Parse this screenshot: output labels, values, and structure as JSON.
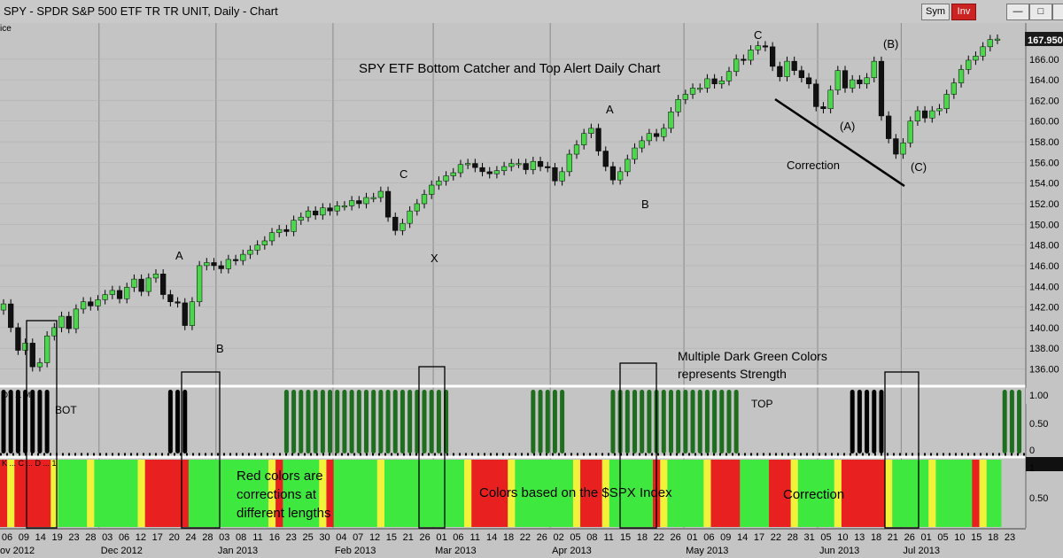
{
  "window": {
    "title": "SPY - SPDR S&P 500 ETF TR TR UNIT, Daily - Chart",
    "sym_button": "Sym",
    "inv_button": "Inv",
    "top_left_fragment": "ice"
  },
  "colors": {
    "up_candle": "#4dd64d",
    "down_candle": "#111111",
    "dark_green": "#1f6e1f",
    "black_bar": "#000000",
    "red": "#e82020",
    "yellow": "#f2f23a",
    "light_green": "#3fe83f",
    "panel_bg": "#c4c4c4",
    "price_label_bg": "#1a1a1a"
  },
  "annotations": {
    "chart_title": "SPY ETF Bottom Catcher and Top Alert Daily Chart",
    "wave_labels": [
      "A",
      "B",
      "C",
      "X",
      "A",
      "B",
      "C",
      "(A)",
      "(B)",
      "(C)"
    ],
    "correction_upper": "Correction",
    "bot_label": "BOT",
    "top_label": "TOP",
    "strength_line1": "Multiple Dark Green Colors",
    "strength_line2": "represents Strength",
    "red_note_line1": "Red colors are",
    "red_note_line2": "corrections at",
    "red_note_line3": "different lengths",
    "spx_note": "Colors based on the $SPX Index",
    "correction_lower": "Correction",
    "panel2_label": "OT ... M",
    "panel3_label": "K ... C ... D ... 1"
  },
  "price_label": "167.950",
  "chart_data": [
    {
      "type": "candlestick",
      "title": "SPY ETF Bottom Catcher and Top Alert Daily Chart",
      "ylim": [
        134.5,
        169.5
      ],
      "yticks": [
        "136.00",
        "138.00",
        "140.00",
        "142.00",
        "144.00",
        "146.00",
        "148.00",
        "150.00",
        "152.00",
        "154.00",
        "156.00",
        "158.00",
        "160.00",
        "162.00",
        "164.00",
        "166.00"
      ],
      "last_price": 167.95,
      "closes": [
        142.3,
        140.0,
        137.8,
        138.5,
        136.2,
        136.6,
        139.2,
        140.0,
        141.1,
        139.9,
        141.8,
        142.5,
        142.1,
        142.7,
        143.2,
        143.6,
        142.8,
        143.9,
        144.7,
        143.5,
        144.8,
        145.2,
        143.2,
        142.5,
        142.4,
        140.2,
        142.5,
        146.0,
        146.3,
        146.0,
        145.7,
        146.6,
        146.5,
        147.1,
        147.5,
        148.0,
        148.4,
        149.2,
        149.5,
        149.3,
        150.4,
        150.7,
        151.3,
        150.9,
        151.6,
        151.3,
        151.8,
        151.8,
        152.3,
        152.0,
        152.6,
        152.6,
        153.2,
        150.7,
        149.4,
        150.1,
        151.3,
        152.0,
        152.9,
        153.8,
        154.2,
        154.7,
        155.0,
        155.8,
        155.9,
        155.5,
        155.1,
        154.9,
        155.2,
        155.6,
        155.9,
        155.9,
        155.3,
        156.1,
        155.6,
        155.5,
        154.2,
        155.1,
        156.8,
        157.7,
        158.8,
        159.3,
        157.1,
        155.6,
        154.3,
        155.1,
        156.3,
        157.4,
        158.1,
        158.8,
        158.5,
        159.3,
        160.9,
        162.1,
        162.6,
        163.2,
        163.2,
        164.1,
        163.6,
        163.9,
        164.8,
        166.0,
        165.9,
        166.9,
        167.3,
        167.2,
        165.3,
        164.3,
        165.8,
        164.9,
        164.2,
        163.6,
        161.4,
        161.2,
        163.0,
        164.9,
        163.2,
        164.0,
        163.6,
        164.2,
        165.8,
        160.5,
        158.3,
        156.8,
        157.9,
        160.0,
        161.0,
        160.3,
        161.0,
        161.2,
        162.6,
        163.7,
        165.0,
        165.9,
        166.3,
        167.2,
        167.9,
        167.95
      ]
    },
    {
      "type": "bar",
      "name_label": "OT ... M",
      "ylim": [
        0,
        1
      ],
      "yticks": [
        "1.00",
        "0.50",
        "0"
      ],
      "colors": [
        "black",
        "black",
        "black",
        "black",
        "black",
        "black",
        "black",
        "black",
        "black",
        "black",
        "black",
        "black",
        "black",
        "black",
        "black",
        "black",
        "black",
        "black",
        "black",
        "black",
        "black",
        "black",
        "black",
        "black",
        "black",
        "black",
        "black",
        "black",
        "black",
        "black",
        "black",
        "black",
        "black",
        "black",
        "black",
        "black",
        "black",
        "black",
        "black",
        "black",
        "black",
        "black",
        "black",
        "black",
        "black",
        "black",
        "black",
        "black",
        "black",
        "black",
        "black",
        "black",
        "black",
        "black",
        "black",
        "black",
        "black",
        "black",
        "black",
        "black",
        "black",
        "black",
        "black",
        "black",
        "black",
        "black",
        "black",
        "black",
        "black",
        "black",
        "black",
        "black",
        "black",
        "black",
        "black",
        "black",
        "black",
        "black",
        "black",
        "black",
        "black",
        "black",
        "black",
        "black",
        "black",
        "black",
        "black",
        "black",
        "black",
        "black",
        "black",
        "black",
        "black",
        "black",
        "black",
        "black",
        "black",
        "black",
        "black",
        "black",
        "black",
        "black",
        "black",
        "black",
        "black",
        "black",
        "black",
        "black",
        "black",
        "black",
        "black",
        "black",
        "black",
        "black",
        "black",
        "black",
        "black",
        "black",
        "black",
        "black",
        "black",
        "black",
        "black",
        "black",
        "black",
        "black",
        "black",
        "black",
        "black",
        "black",
        "black",
        "black",
        "black",
        "black",
        "black",
        "black",
        "black",
        "black",
        "black",
        "black"
      ],
      "values": [
        1,
        1,
        1,
        1,
        1,
        1,
        1,
        0,
        0,
        0,
        0,
        0,
        0,
        0,
        0,
        0,
        0,
        0,
        0,
        0,
        0,
        0,
        0,
        1,
        1,
        1,
        0,
        0,
        0,
        0,
        0,
        0,
        0,
        0,
        0,
        0,
        0,
        0,
        0,
        1,
        1,
        1,
        1,
        1,
        1,
        1,
        1,
        1,
        1,
        1,
        1,
        1,
        1,
        1,
        1,
        1,
        1,
        1,
        1,
        1,
        1,
        1,
        0,
        0,
        0,
        0,
        0,
        0,
        0,
        0,
        0,
        0,
        0,
        1,
        1,
        1,
        1,
        1,
        0,
        0,
        0,
        0,
        0,
        0,
        1,
        1,
        1,
        1,
        1,
        1,
        1,
        1,
        1,
        1,
        1,
        1,
        1,
        1,
        1,
        1,
        1,
        1,
        0,
        0,
        0,
        0,
        0,
        0,
        0,
        0,
        0,
        0,
        0,
        0,
        0,
        0,
        0,
        1,
        1,
        1,
        1,
        1,
        0,
        0,
        0,
        0,
        0,
        0,
        0,
        0,
        0,
        0,
        0,
        0,
        0,
        0,
        0,
        0,
        1,
        1,
        1
      ]
    },
    {
      "type": "bar",
      "name_label": "K ... C ... D ... 1",
      "ylim": [
        0,
        1
      ],
      "yticks": [
        "1",
        "0.50"
      ],
      "categories": [
        "06",
        "09",
        "14",
        "19",
        "23",
        "28",
        "03",
        "06",
        "12",
        "17",
        "20",
        "24",
        "28",
        "03",
        "08",
        "11",
        "16",
        "23",
        "25",
        "30",
        "04",
        "07",
        "12",
        "15",
        "21",
        "26",
        "01",
        "06",
        "11",
        "14",
        "18",
        "22",
        "26",
        "02",
        "05",
        "08",
        "11",
        "15",
        "18",
        "22",
        "26",
        "01",
        "06",
        "09",
        "14",
        "17",
        "22",
        "28",
        "31",
        "05",
        "10",
        "13",
        "18",
        "21",
        "26",
        "01",
        "05",
        "10",
        "15",
        "18",
        "23"
      ],
      "x_month_labels": [
        "ov 2012",
        "Dec 2012",
        "Jan 2013",
        "Feb 2013",
        "Mar 2013",
        "Apr 2013",
        "May 2013",
        "Jun 2013",
        "Jul 2013"
      ]
    }
  ]
}
